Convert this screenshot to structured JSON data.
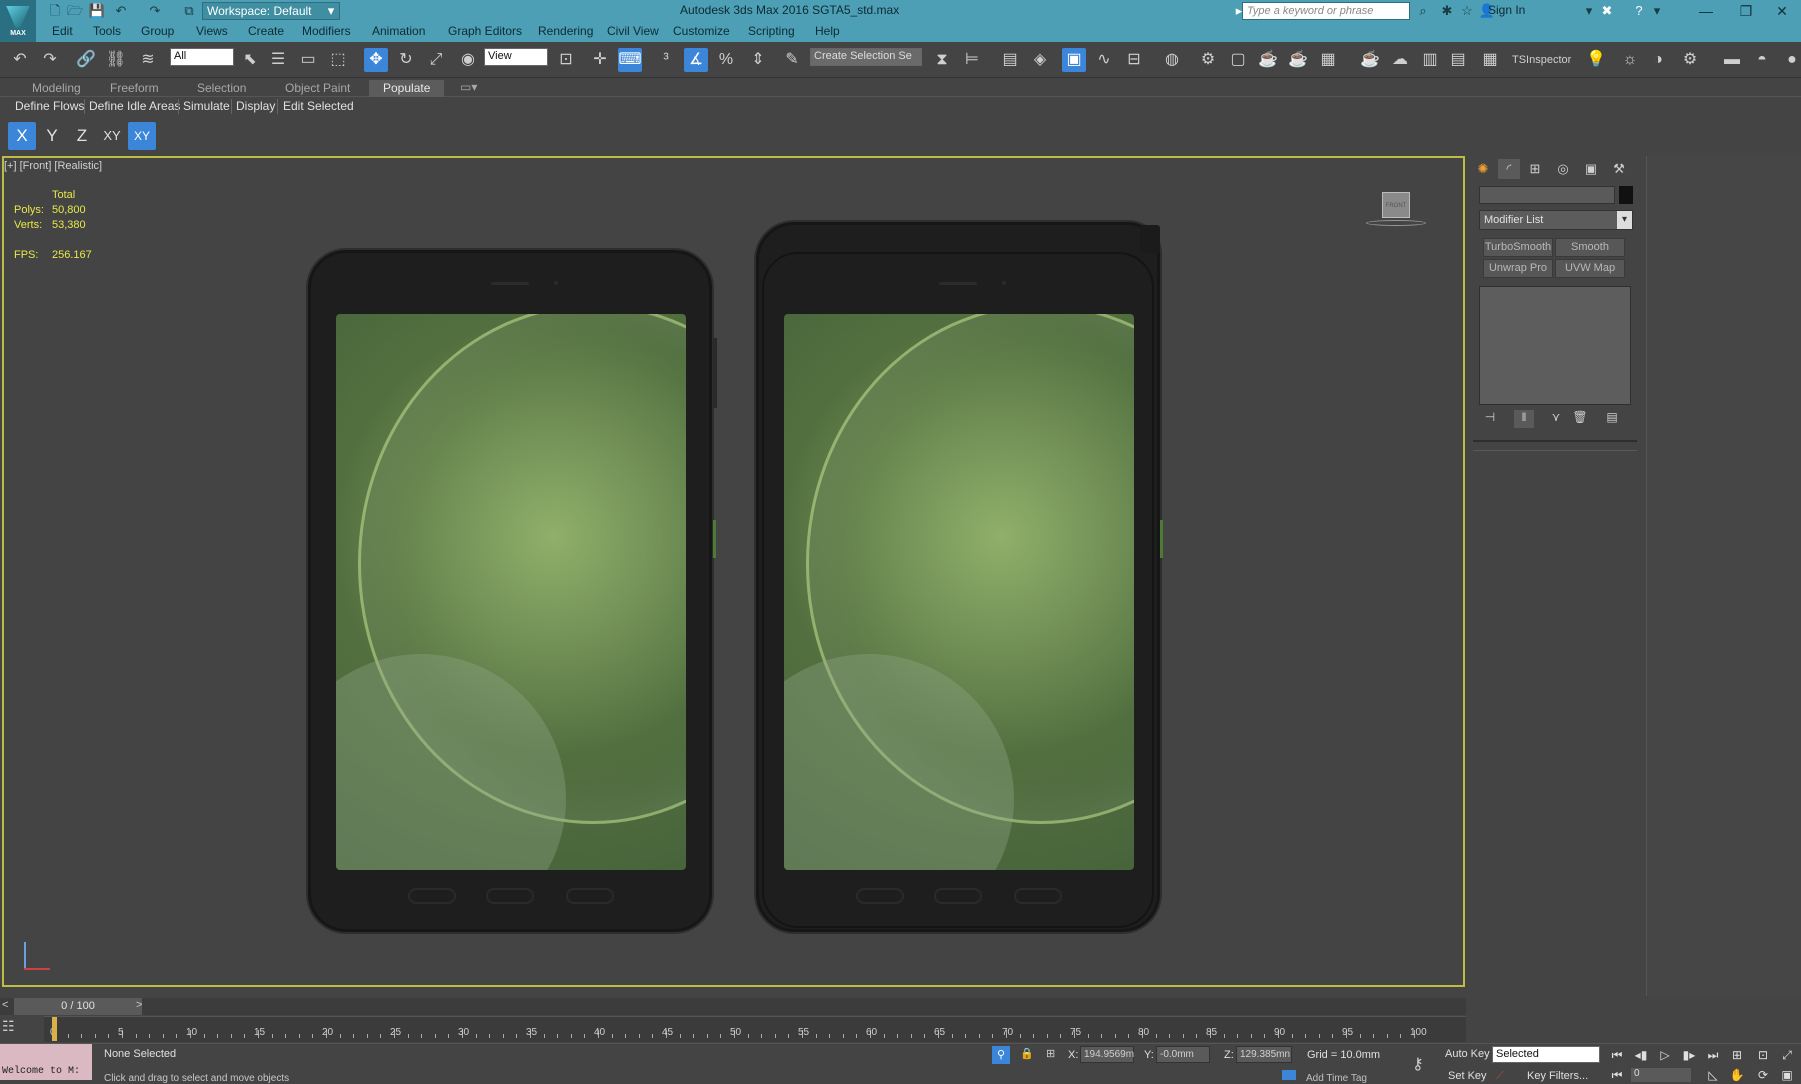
{
  "app": {
    "title": "Autodesk 3ds Max 2016    SGTA5_std.max",
    "workspace": "Workspace: Default",
    "search_placeholder": "Type a keyword or phrase",
    "sign_in": "Sign In",
    "logo_text": "MAX"
  },
  "menu": [
    "Edit",
    "Tools",
    "Group",
    "Views",
    "Create",
    "Modifiers",
    "Animation",
    "Graph Editors",
    "Rendering",
    "Civil View",
    "Customize",
    "Scripting",
    "Help"
  ],
  "toolbar": {
    "filter_value": "All",
    "refcoord_value": "View",
    "named_selection_placeholder": "Create Selection Se",
    "tsinspector": "TSInspector"
  },
  "ribbon": {
    "tabs": [
      "Modeling",
      "Freeform",
      "Selection",
      "Object Paint",
      "Populate"
    ],
    "active_tab": "Populate",
    "buttons": [
      "Define Flows",
      "Define Idle Areas",
      "Simulate",
      "Display",
      "Edit Selected"
    ]
  },
  "axis": [
    "X",
    "Y",
    "Z",
    "XY",
    "XY"
  ],
  "viewport": {
    "label": "[+] [Front] [Realistic]",
    "stats_header": "Total",
    "polys_label": "Polys:",
    "polys_value": "50,800",
    "verts_label": "Verts:",
    "verts_value": "53,380",
    "fps_label": "FPS:",
    "fps_value": "256.167",
    "viewcube_label": "FRONT"
  },
  "command_panel": {
    "modifier_list": "Modifier List",
    "mod_buttons": [
      "TurboSmooth",
      "Smooth",
      "Unwrap Pro",
      "UVW Map"
    ]
  },
  "timeline": {
    "slider": "0 / 100",
    "labels": [
      "0",
      "5",
      "10",
      "15",
      "20",
      "25",
      "30",
      "35",
      "40",
      "45",
      "50",
      "55",
      "60",
      "65",
      "70",
      "75",
      "80",
      "85",
      "90",
      "95",
      "100"
    ]
  },
  "status": {
    "welcome": "Welcome to M:",
    "selection": "None Selected",
    "prompt": "Click and drag to select and move objects",
    "x_label": "X:",
    "x_value": "194.9569m",
    "y_label": "Y:",
    "y_value": "-0.0mm",
    "z_label": "Z:",
    "z_value": "129.385mn",
    "grid": "Grid = 10.0mm",
    "auto_key": "Auto Key",
    "selected_dd": "Selected",
    "set_key": "Set Key",
    "key_filters": "Key Filters...",
    "add_time_tag": "Add Time Tag",
    "frame": "0"
  },
  "colors": {
    "titlebar": "#4c9fb4",
    "active_tool": "#3b86d8",
    "viewport_border": "#bdbd44",
    "stats_text": "#e8e84a"
  }
}
